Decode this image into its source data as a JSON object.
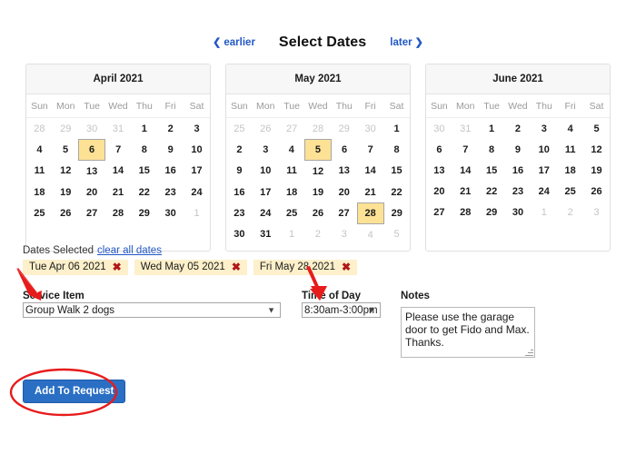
{
  "header": {
    "earlier_label": "earlier",
    "later_label": "later",
    "title": "Select Dates",
    "link_color": "#2257c5"
  },
  "calendars": [
    {
      "name": "april-2021",
      "title": "April 2021",
      "weekdays": [
        "Sun",
        "Mon",
        "Tue",
        "Wed",
        "Thu",
        "Fri",
        "Sat"
      ],
      "weeks": [
        [
          {
            "d": "28",
            "muted": true
          },
          {
            "d": "29",
            "muted": true
          },
          {
            "d": "30",
            "muted": true
          },
          {
            "d": "31",
            "muted": true
          },
          {
            "d": "1"
          },
          {
            "d": "2"
          },
          {
            "d": "3"
          }
        ],
        [
          {
            "d": "4"
          },
          {
            "d": "5"
          },
          {
            "d": "6",
            "selected": true
          },
          {
            "d": "7"
          },
          {
            "d": "8"
          },
          {
            "d": "9"
          },
          {
            "d": "10"
          }
        ],
        [
          {
            "d": "11"
          },
          {
            "d": "12"
          },
          {
            "d": "13"
          },
          {
            "d": "14"
          },
          {
            "d": "15"
          },
          {
            "d": "16"
          },
          {
            "d": "17"
          }
        ],
        [
          {
            "d": "18"
          },
          {
            "d": "19"
          },
          {
            "d": "20"
          },
          {
            "d": "21"
          },
          {
            "d": "22"
          },
          {
            "d": "23"
          },
          {
            "d": "24"
          }
        ],
        [
          {
            "d": "25"
          },
          {
            "d": "26"
          },
          {
            "d": "27"
          },
          {
            "d": "28"
          },
          {
            "d": "29"
          },
          {
            "d": "30"
          },
          {
            "d": "1",
            "muted": true
          }
        ]
      ]
    },
    {
      "name": "may-2021",
      "title": "May 2021",
      "weekdays": [
        "Sun",
        "Mon",
        "Tue",
        "Wed",
        "Thu",
        "Fri",
        "Sat"
      ],
      "weeks": [
        [
          {
            "d": "25",
            "muted": true
          },
          {
            "d": "26",
            "muted": true
          },
          {
            "d": "27",
            "muted": true
          },
          {
            "d": "28",
            "muted": true
          },
          {
            "d": "29",
            "muted": true
          },
          {
            "d": "30",
            "muted": true
          },
          {
            "d": "1"
          }
        ],
        [
          {
            "d": "2"
          },
          {
            "d": "3"
          },
          {
            "d": "4"
          },
          {
            "d": "5",
            "selected": true
          },
          {
            "d": "6"
          },
          {
            "d": "7"
          },
          {
            "d": "8"
          }
        ],
        [
          {
            "d": "9"
          },
          {
            "d": "10"
          },
          {
            "d": "11"
          },
          {
            "d": "12"
          },
          {
            "d": "13"
          },
          {
            "d": "14"
          },
          {
            "d": "15"
          }
        ],
        [
          {
            "d": "16"
          },
          {
            "d": "17"
          },
          {
            "d": "18"
          },
          {
            "d": "19"
          },
          {
            "d": "20"
          },
          {
            "d": "21"
          },
          {
            "d": "22"
          }
        ],
        [
          {
            "d": "23"
          },
          {
            "d": "24"
          },
          {
            "d": "25"
          },
          {
            "d": "26"
          },
          {
            "d": "27"
          },
          {
            "d": "28",
            "selected": true
          },
          {
            "d": "29"
          }
        ],
        [
          {
            "d": "30"
          },
          {
            "d": "31"
          },
          {
            "d": "1",
            "muted": true
          },
          {
            "d": "2",
            "muted": true
          },
          {
            "d": "3",
            "muted": true
          },
          {
            "d": "4",
            "muted": true
          },
          {
            "d": "5",
            "muted": true
          }
        ]
      ]
    },
    {
      "name": "june-2021",
      "title": "June 2021",
      "weekdays": [
        "Sun",
        "Mon",
        "Tue",
        "Wed",
        "Thu",
        "Fri",
        "Sat"
      ],
      "weeks": [
        [
          {
            "d": "30",
            "muted": true
          },
          {
            "d": "31",
            "muted": true
          },
          {
            "d": "1"
          },
          {
            "d": "2"
          },
          {
            "d": "3"
          },
          {
            "d": "4"
          },
          {
            "d": "5"
          }
        ],
        [
          {
            "d": "6"
          },
          {
            "d": "7"
          },
          {
            "d": "8"
          },
          {
            "d": "9"
          },
          {
            "d": "10"
          },
          {
            "d": "11"
          },
          {
            "d": "12"
          }
        ],
        [
          {
            "d": "13"
          },
          {
            "d": "14"
          },
          {
            "d": "15"
          },
          {
            "d": "16"
          },
          {
            "d": "17"
          },
          {
            "d": "18"
          },
          {
            "d": "19"
          }
        ],
        [
          {
            "d": "20"
          },
          {
            "d": "21"
          },
          {
            "d": "22"
          },
          {
            "d": "23"
          },
          {
            "d": "24"
          },
          {
            "d": "25"
          },
          {
            "d": "26"
          }
        ],
        [
          {
            "d": "27"
          },
          {
            "d": "28"
          },
          {
            "d": "29"
          },
          {
            "d": "30"
          },
          {
            "d": "1",
            "muted": true
          },
          {
            "d": "2",
            "muted": true
          },
          {
            "d": "3",
            "muted": true
          }
        ]
      ]
    }
  ],
  "selected_dates": {
    "label": "Dates Selected",
    "clear_all_label": "clear all dates",
    "remove_icon": "✖",
    "chips": [
      {
        "label": "Tue Apr 06 2021"
      },
      {
        "label": "Wed May 05 2021"
      },
      {
        "label": "Fri May 28 2021"
      }
    ],
    "chip_bg": "#fdf0cb",
    "remove_color": "#b01818"
  },
  "form": {
    "service": {
      "label": "Service Item",
      "value": "Group Walk 2 dogs",
      "options": [
        "Group Walk 2 dogs"
      ]
    },
    "time_of_day": {
      "label": "Time of Day",
      "value": "8:30am-3:00pm",
      "options": [
        "8:30am-3:00pm"
      ]
    },
    "notes": {
      "label": "Notes",
      "value": "Please use the garage door to get Fido and Max. Thanks.",
      "placeholder": ""
    }
  },
  "submit": {
    "label": "Add To Request",
    "bg": "#2a6fc4"
  },
  "annotations": {
    "color": "#e81b1b",
    "highlight_color": "#fde195",
    "ellipse_target": "Add To Request",
    "arrow_service_target": "Service Item",
    "arrow_tod_target": "Time of Day"
  }
}
